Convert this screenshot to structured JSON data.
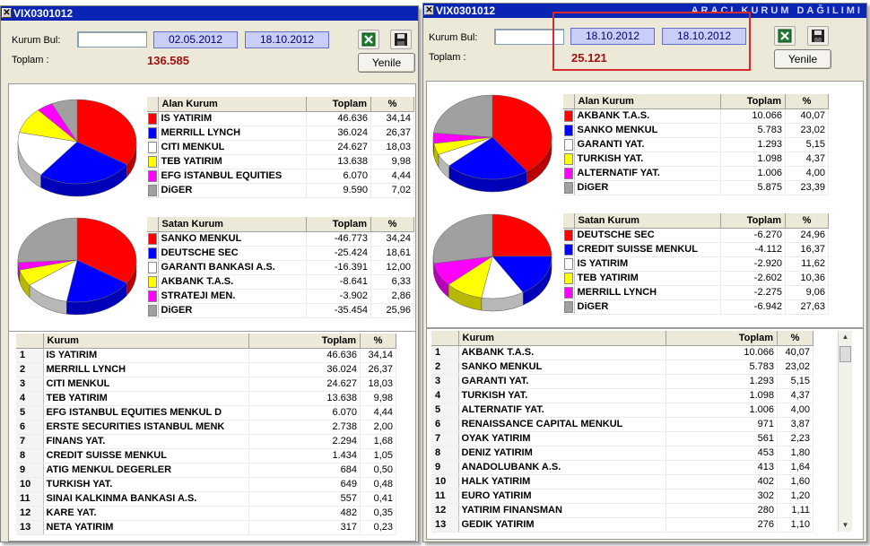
{
  "left": {
    "title": "VIX0301012",
    "kurum_bul_label": "Kurum Bul:",
    "kurum_bul_value": "",
    "date_from": "02.05.2012",
    "date_to": "18.10.2012",
    "toplam_label": "Toplam :",
    "toplam_value": "136.585",
    "refresh_label": "Yenile",
    "alan": {
      "headers": [
        "Alan Kurum",
        "Toplam",
        "%"
      ],
      "rows": [
        {
          "name": "IS YATIRIM",
          "total": "46.636",
          "pct": "34,14",
          "color": "#ff0000",
          "v": 34.14
        },
        {
          "name": "MERRILL LYNCH",
          "total": "36.024",
          "pct": "26,37",
          "color": "#0000ff",
          "v": 26.37
        },
        {
          "name": "CITI MENKUL",
          "total": "24.627",
          "pct": "18,03",
          "color": "#ffffff",
          "v": 18.03
        },
        {
          "name": "TEB YATIRIM",
          "total": "13.638",
          "pct": "9,98",
          "color": "#ffff00",
          "v": 9.98
        },
        {
          "name": "EFG ISTANBUL EQUITIES",
          "total": "6.070",
          "pct": "4,44",
          "color": "#ff00ff",
          "v": 4.44
        },
        {
          "name": "DiGER",
          "total": "9.590",
          "pct": "7,02",
          "color": "#a0a0a0",
          "v": 7.02
        }
      ]
    },
    "satan": {
      "headers": [
        "Satan Kurum",
        "Toplam",
        "%"
      ],
      "rows": [
        {
          "name": "SANKO MENKUL",
          "total": "-46.773",
          "pct": "34,24",
          "color": "#ff0000",
          "v": 34.24
        },
        {
          "name": "DEUTSCHE SEC",
          "total": "-25.424",
          "pct": "18,61",
          "color": "#0000ff",
          "v": 18.61
        },
        {
          "name": "GARANTI BANKASI A.S.",
          "total": "-16.391",
          "pct": "12,00",
          "color": "#ffffff",
          "v": 12.0
        },
        {
          "name": "AKBANK T.A.S.",
          "total": "-8.641",
          "pct": "6,33",
          "color": "#ffff00",
          "v": 6.33
        },
        {
          "name": "STRATEJI MEN.",
          "total": "-3.902",
          "pct": "2,86",
          "color": "#ff00ff",
          "v": 2.86
        },
        {
          "name": "DiGER",
          "total": "-35.454",
          "pct": "25,96",
          "color": "#a0a0a0",
          "v": 25.96
        }
      ]
    },
    "list": {
      "headers": [
        "Kurum",
        "Toplam",
        "%"
      ],
      "rows": [
        {
          "no": "1",
          "name": "IS YATIRIM",
          "total": "46.636",
          "pct": "34,14"
        },
        {
          "no": "2",
          "name": "MERRILL LYNCH",
          "total": "36.024",
          "pct": "26,37"
        },
        {
          "no": "3",
          "name": "CITI MENKUL",
          "total": "24.627",
          "pct": "18,03"
        },
        {
          "no": "4",
          "name": "TEB YATIRIM",
          "total": "13.638",
          "pct": "9,98"
        },
        {
          "no": "5",
          "name": "EFG ISTANBUL EQUITIES MENKUL D",
          "total": "6.070",
          "pct": "4,44"
        },
        {
          "no": "6",
          "name": "ERSTE SECURITIES ISTANBUL MENK",
          "total": "2.738",
          "pct": "2,00"
        },
        {
          "no": "7",
          "name": "FINANS YAT.",
          "total": "2.294",
          "pct": "1,68"
        },
        {
          "no": "8",
          "name": "CREDIT SUISSE MENKUL",
          "total": "1.434",
          "pct": "1,05"
        },
        {
          "no": "9",
          "name": "ATIG MENKUL DEGERLER",
          "total": "684",
          "pct": "0,50"
        },
        {
          "no": "10",
          "name": "TURKISH YAT.",
          "total": "649",
          "pct": "0,48"
        },
        {
          "no": "11",
          "name": "SINAI KALKINMA BANKASI A.S.",
          "total": "557",
          "pct": "0,41"
        },
        {
          "no": "12",
          "name": "KARE YAT.",
          "total": "482",
          "pct": "0,35"
        },
        {
          "no": "13",
          "name": "NETA YATIRIM",
          "total": "317",
          "pct": "0,23"
        }
      ]
    }
  },
  "right": {
    "title": "VIX0301012",
    "dist_title": "ARACI KURUM DAĞILIMI",
    "kurum_bul_label": "Kurum Bul:",
    "kurum_bul_value": "",
    "date_from": "18.10.2012",
    "date_to": "18.10.2012",
    "toplam_label": "Toplam :",
    "toplam_value": "25.121",
    "refresh_label": "Yenile",
    "alan": {
      "headers": [
        "Alan Kurum",
        "Toplam",
        "%"
      ],
      "rows": [
        {
          "name": "AKBANK T.A.S.",
          "total": "10.066",
          "pct": "40,07",
          "color": "#ff0000",
          "v": 40.07
        },
        {
          "name": "SANKO MENKUL",
          "total": "5.783",
          "pct": "23,02",
          "color": "#0000ff",
          "v": 23.02
        },
        {
          "name": "GARANTI YAT.",
          "total": "1.293",
          "pct": "5,15",
          "color": "#ffffff",
          "v": 5.15
        },
        {
          "name": "TURKISH YAT.",
          "total": "1.098",
          "pct": "4,37",
          "color": "#ffff00",
          "v": 4.37
        },
        {
          "name": "ALTERNATIF YAT.",
          "total": "1.006",
          "pct": "4,00",
          "color": "#ff00ff",
          "v": 4.0
        },
        {
          "name": "DiGER",
          "total": "5.875",
          "pct": "23,39",
          "color": "#a0a0a0",
          "v": 23.39
        }
      ]
    },
    "satan": {
      "headers": [
        "Satan Kurum",
        "Toplam",
        "%"
      ],
      "rows": [
        {
          "name": "DEUTSCHE SEC",
          "total": "-6.270",
          "pct": "24,96",
          "color": "#ff0000",
          "v": 24.96
        },
        {
          "name": "CREDIT SUISSE MENKUL",
          "total": "-4.112",
          "pct": "16,37",
          "color": "#0000ff",
          "v": 16.37
        },
        {
          "name": "IS YATIRIM",
          "total": "-2.920",
          "pct": "11,62",
          "color": "#ffffff",
          "v": 11.62
        },
        {
          "name": "TEB YATIRIM",
          "total": "-2.602",
          "pct": "10,36",
          "color": "#ffff00",
          "v": 10.36
        },
        {
          "name": "MERRILL LYNCH",
          "total": "-2.275",
          "pct": "9,06",
          "color": "#ff00ff",
          "v": 9.06
        },
        {
          "name": "DiGER",
          "total": "-6.942",
          "pct": "27,63",
          "color": "#a0a0a0",
          "v": 27.63
        }
      ]
    },
    "list": {
      "headers": [
        "Kurum",
        "Toplam",
        "%"
      ],
      "rows": [
        {
          "no": "1",
          "name": "AKBANK T.A.S.",
          "total": "10.066",
          "pct": "40,07"
        },
        {
          "no": "2",
          "name": "SANKO MENKUL",
          "total": "5.783",
          "pct": "23,02"
        },
        {
          "no": "3",
          "name": "GARANTI YAT.",
          "total": "1.293",
          "pct": "5,15"
        },
        {
          "no": "4",
          "name": "TURKISH YAT.",
          "total": "1.098",
          "pct": "4,37"
        },
        {
          "no": "5",
          "name": "ALTERNATIF YAT.",
          "total": "1.006",
          "pct": "4,00"
        },
        {
          "no": "6",
          "name": "RENAISSANCE CAPITAL MENKUL",
          "total": "971",
          "pct": "3,87"
        },
        {
          "no": "7",
          "name": "OYAK YATIRIM",
          "total": "561",
          "pct": "2,23"
        },
        {
          "no": "8",
          "name": "DENIZ YATIRIM",
          "total": "453",
          "pct": "1,80"
        },
        {
          "no": "9",
          "name": "ANADOLUBANK A.S.",
          "total": "413",
          "pct": "1,64"
        },
        {
          "no": "10",
          "name": "HALK YATIRIM",
          "total": "402",
          "pct": "1,60"
        },
        {
          "no": "11",
          "name": "EURO YATIRIM",
          "total": "302",
          "pct": "1,20"
        },
        {
          "no": "12",
          "name": "YATIRIM FINANSMAN",
          "total": "280",
          "pct": "1,11"
        },
        {
          "no": "13",
          "name": "GEDIK YATIRIM",
          "total": "276",
          "pct": "1,10"
        }
      ]
    }
  }
}
